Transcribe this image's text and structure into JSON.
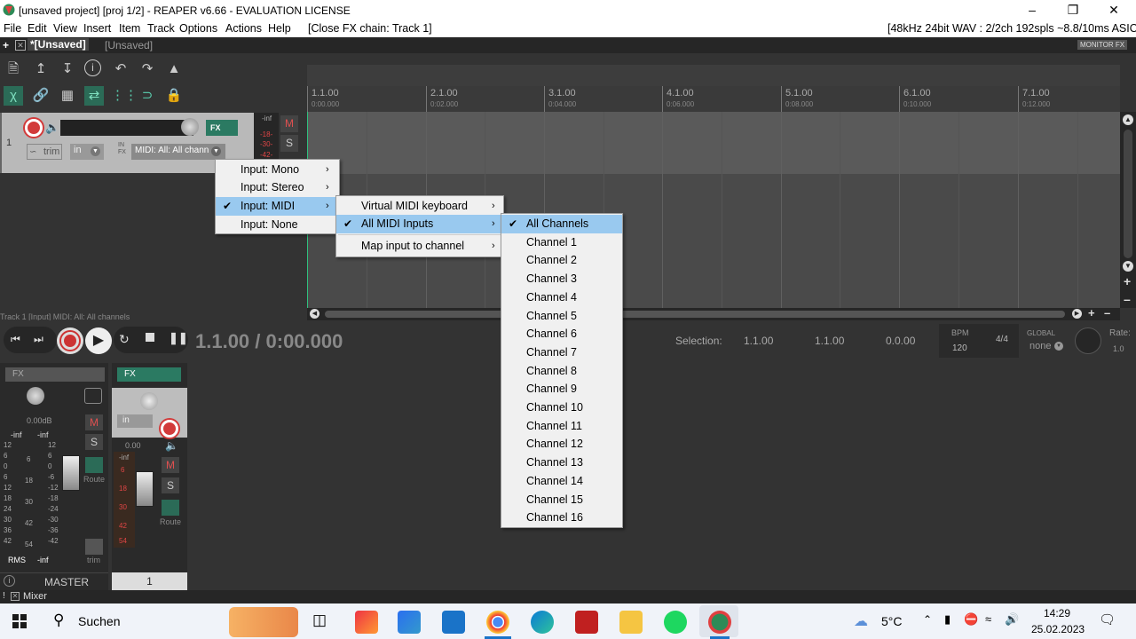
{
  "window": {
    "title": "[unsaved project] [proj 1/2] - REAPER v6.66 - EVALUATION LICENSE"
  },
  "menubar": {
    "items": [
      "File",
      "Edit",
      "View",
      "Insert",
      "Item",
      "Track",
      "Options",
      "Actions",
      "Help"
    ],
    "fx_chain": "[Close FX chain: Track 1]",
    "audio_info": "[48kHz 24bit WAV : 2/2ch 192spls ~8.8/10ms ASIO]"
  },
  "tabs": {
    "plus": "+",
    "active": "*[Unsaved]",
    "inactive": "[Unsaved]",
    "monitor_fx": "MONITOR FX"
  },
  "ruler": [
    {
      "bar": "1.1.00",
      "time": "0:00.000"
    },
    {
      "bar": "2.1.00",
      "time": "0:02.000"
    },
    {
      "bar": "3.1.00",
      "time": "0:04.000"
    },
    {
      "bar": "4.1.00",
      "time": "0:06.000"
    },
    {
      "bar": "5.1.00",
      "time": "0:08.000"
    },
    {
      "bar": "6.1.00",
      "time": "0:10.000"
    },
    {
      "bar": "7.1.00",
      "time": "0:12.000"
    }
  ],
  "track": {
    "number": "1",
    "trim": "trim",
    "in": "in",
    "input": "MIDI: All: All chann",
    "fx": "FX",
    "meter_labels": [
      "-inf",
      "-18-",
      "-30-",
      "-42-"
    ],
    "m": "M",
    "s": "S",
    "status": "Track 1 [Input] MIDI: All: All channels"
  },
  "menu1": {
    "items": [
      {
        "label": "Input: Mono",
        "checked": false
      },
      {
        "label": "Input: Stereo",
        "checked": false
      },
      {
        "label": "Input: MIDI",
        "checked": true
      },
      {
        "label": "Input: None",
        "checked": false
      }
    ]
  },
  "menu2": {
    "items": [
      {
        "label": "Virtual MIDI keyboard",
        "checked": false
      },
      {
        "label": "All MIDI Inputs",
        "checked": true
      },
      {
        "label": "Map input to channel",
        "checked": false
      }
    ]
  },
  "menu3": {
    "items": [
      "All Channels",
      "Channel 1",
      "Channel 2",
      "Channel 3",
      "Channel 4",
      "Channel 5",
      "Channel 6",
      "Channel 7",
      "Channel 8",
      "Channel 9",
      "Channel 10",
      "Channel 11",
      "Channel 12",
      "Channel 13",
      "Channel 14",
      "Channel 15",
      "Channel 16"
    ],
    "checked_index": 0
  },
  "transport": {
    "time": "1.1.00 / 0:00.000",
    "selection_label": "Selection:",
    "sel_start": "1.1.00",
    "sel_end": "1.1.00",
    "sel_len": "0.0.00",
    "bpm_label": "BPM",
    "bpm": "120",
    "sig": "4/4",
    "global_label": "GLOBAL",
    "global_val": "none",
    "rate_label": "Rate:",
    "rate": "1.0"
  },
  "mixer": {
    "master": {
      "fx": "FX",
      "vol": "0.00dB",
      "left": "-inf",
      "right": "-inf",
      "rms": "RMS",
      "rms_val": "-inf",
      "m": "M",
      "s": "S",
      "route": "Route",
      "trim": "trim",
      "name": "MASTER",
      "scale": [
        "12",
        "6",
        "0",
        "6",
        "12",
        "18",
        "24",
        "30",
        "36",
        "42"
      ],
      "scale2": [
        "12",
        "6",
        "0",
        "-6",
        "-12",
        "-18",
        "-24",
        "-30",
        "-36",
        "-42"
      ],
      "inner": [
        "6",
        "18",
        "30",
        "42",
        "54"
      ]
    },
    "track1": {
      "fx": "FX",
      "in": "in",
      "vol": "0.00",
      "meter": [
        "-inf",
        "6",
        "18",
        "30",
        "42",
        "54"
      ],
      "m": "M",
      "s": "S",
      "route": "Route",
      "number": "1"
    },
    "tab": "Mixer"
  },
  "taskbar": {
    "search": "Suchen",
    "weather": "5°C",
    "time": "14:29",
    "date": "25.02.2023"
  }
}
